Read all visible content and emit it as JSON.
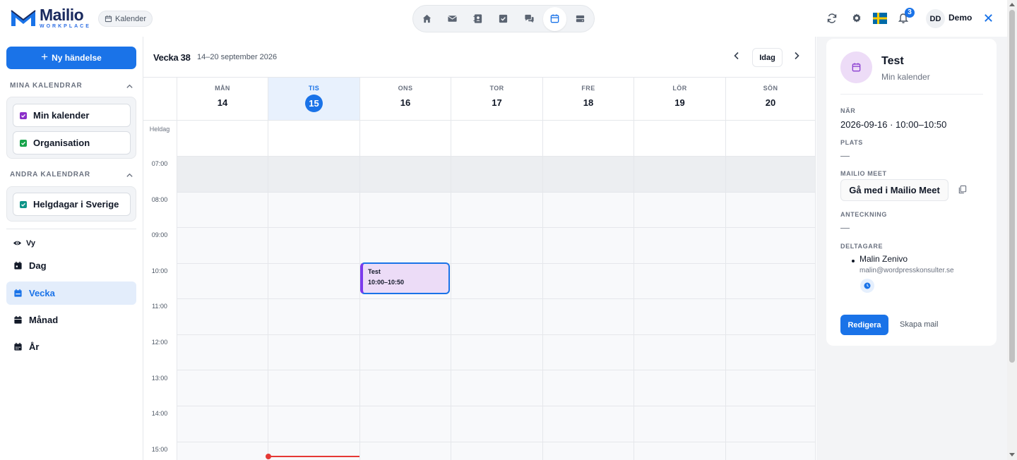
{
  "brand": {
    "name": "Mailio",
    "sub": "WORKPLACE"
  },
  "app_chip": "Kalender",
  "nav_icons": [
    "home-icon",
    "mail-icon",
    "contacts-icon",
    "tasks-icon",
    "chat-icon",
    "calendar-icon",
    "storage-icon"
  ],
  "topbar": {
    "notification_count": "3",
    "avatar_initials": "DD",
    "user_name": "Demo"
  },
  "sidebar": {
    "new_event": "Ny händelse",
    "my_calendars_heading": "MINA KALENDRAR",
    "my_calendars": [
      {
        "label": "Min kalender",
        "color": "#8b2fc9"
      },
      {
        "label": "Organisation",
        "color": "#16a34a"
      }
    ],
    "other_calendars_heading": "ANDRA KALENDRAR",
    "other_calendars": [
      {
        "label": "Helgdagar i Sverige",
        "color": "#0d9488"
      }
    ],
    "view_heading": "Vy",
    "views": [
      {
        "label": "Dag",
        "active": false
      },
      {
        "label": "Vecka",
        "active": true
      },
      {
        "label": "Månad",
        "active": false
      },
      {
        "label": "År",
        "active": false
      }
    ]
  },
  "calendar": {
    "week_title": "Vecka 38",
    "week_range": "14–20 september 2026",
    "today_button": "Idag",
    "allday_label": "Heldag",
    "days": [
      {
        "name": "MÅN",
        "num": "14",
        "today": false
      },
      {
        "name": "TIS",
        "num": "15",
        "today": true
      },
      {
        "name": "ONS",
        "num": "16",
        "today": false
      },
      {
        "name": "TOR",
        "num": "17",
        "today": false
      },
      {
        "name": "FRE",
        "num": "18",
        "today": false
      },
      {
        "name": "LÖR",
        "num": "19",
        "today": false
      },
      {
        "name": "SÖN",
        "num": "20",
        "today": false
      }
    ],
    "hours": [
      "07:00",
      "08:00",
      "09:00",
      "10:00",
      "11:00",
      "12:00",
      "13:00",
      "14:00",
      "15:00"
    ],
    "event": {
      "title": "Test",
      "time": "10:00–10:50"
    }
  },
  "detail": {
    "title": "Test",
    "calendar": "Min kalender",
    "when_label": "NÄR",
    "when_value": "2026-09-16 · 10:00–10:50",
    "place_label": "PLATS",
    "place_value": "—",
    "meet_label": "MAILIO MEET",
    "meet_button": "Gå med i Mailio Meet",
    "note_label": "ANTECKNING",
    "note_value": "—",
    "participants_label": "DELTAGARE",
    "participant_name": "Malin Zenivo",
    "participant_email": "malin@wordpresskonsulter.se",
    "edit_button": "Redigera",
    "mail_button": "Skapa mail"
  },
  "colors": {
    "accent": "#1a73e8",
    "event_bg": "#ecdcf7",
    "event_border": "#7c3aed",
    "now_line": "#e53935"
  }
}
